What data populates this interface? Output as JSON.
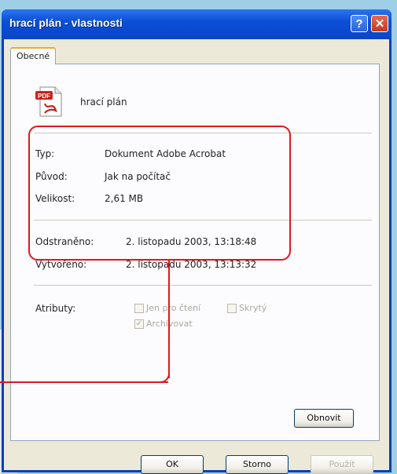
{
  "window": {
    "title": "hrací plán - vlastnosti",
    "help_label": "?",
    "close_label": "✕"
  },
  "tabs": [
    {
      "label": "Obecné"
    }
  ],
  "file": {
    "name": "hrací plán",
    "icon": "pdf-file-icon"
  },
  "details": {
    "type_label": "Typ:",
    "type_value": "Dokument Adobe Acrobat",
    "origin_label": "Původ:",
    "origin_value": "Jak na počítač",
    "size_label": "Velikost:",
    "size_value": "2,61 MB",
    "deleted_label": "Odstraněno:",
    "deleted_value": "2. listopadu 2003, 13:18:48",
    "created_label": "Vytvořeno:",
    "created_value": "2. listopadu 2003, 13:13:32"
  },
  "attributes": {
    "label": "Atributy:",
    "readonly_label": "Jen pro čtení",
    "readonly_checked": false,
    "hidden_label": "Skrytý",
    "hidden_checked": false,
    "archive_label": "Archivovat",
    "archive_checked": true
  },
  "buttons": {
    "restore": "Obnovit",
    "ok": "OK",
    "cancel": "Storno",
    "apply": "Použít"
  },
  "colors": {
    "highlight": "#e2181b",
    "titlebar": "#0b4fd8",
    "dialog": "#ece9d8"
  }
}
